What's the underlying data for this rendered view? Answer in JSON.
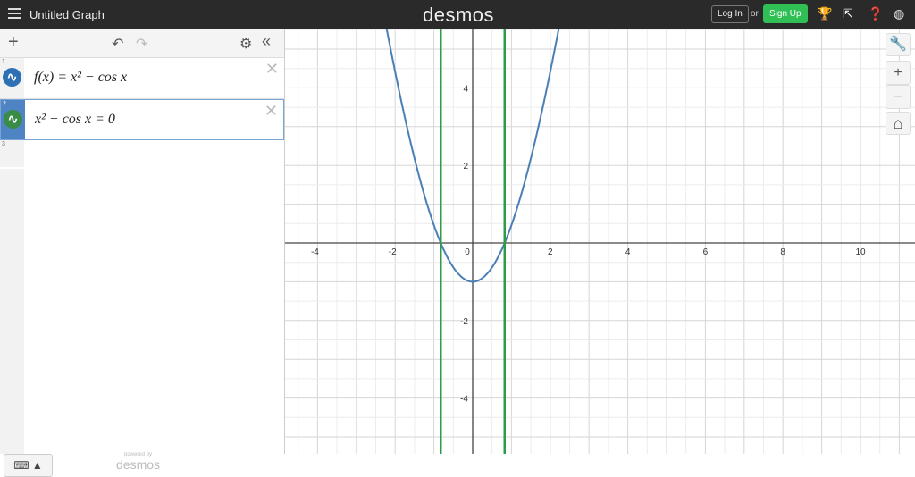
{
  "header": {
    "title": "Untitled Graph",
    "logo": "desmos",
    "login": "Log In",
    "or": "or",
    "signup": "Sign Up",
    "icons": [
      "trophy-icon",
      "share-icon",
      "help-icon",
      "globe-icon"
    ]
  },
  "toolbar": {
    "add": "+",
    "undo": "↶",
    "redo": "↷",
    "settings": "⚙",
    "collapse": "«"
  },
  "expressions": [
    {
      "num": "1",
      "latex": "f(x) = x² − cos x",
      "color": "#2d70b3"
    },
    {
      "num": "2",
      "latex": "x² − cos x = 0",
      "color": "#388c46"
    },
    {
      "num": "3",
      "latex": ""
    }
  ],
  "keyboard": "⌨ ▲",
  "powered": {
    "small": "powered by",
    "brand": "desmos"
  },
  "graph": {
    "xticks": [
      "-4",
      "-2",
      "0",
      "2",
      "4",
      "6",
      "8",
      "10"
    ],
    "yticks": [
      "4",
      "2",
      "-2",
      "-4"
    ],
    "xrange": [
      -4.8,
      11.4
    ],
    "yrange": [
      -5.5,
      5.5
    ],
    "roots": [
      -0.824,
      0.824
    ],
    "curve_color": "#4a7fb5",
    "root_color": "#2e9b47"
  },
  "right": {
    "wrench": "🔧",
    "zoom_in": "+",
    "zoom_out": "−",
    "home": "⌂"
  }
}
